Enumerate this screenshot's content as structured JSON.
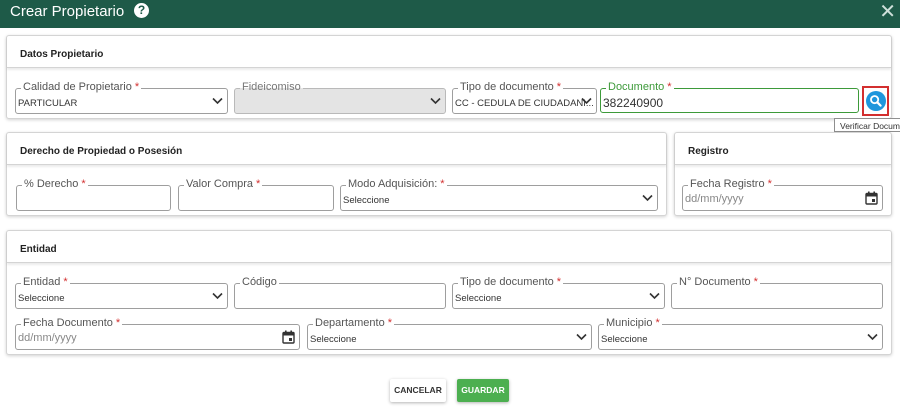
{
  "dialog": {
    "title": "Crear Propietario",
    "help_icon": "?",
    "close_icon": "✕"
  },
  "datos_propietario": {
    "heading": "Datos Propietario",
    "calidad": {
      "label": "Calidad de Propietario",
      "value": "PARTICULAR"
    },
    "fideicomiso": {
      "label": "Fideicomiso",
      "value": ""
    },
    "tipo_documento": {
      "label": "Tipo de documento",
      "value": "CC - CEDULA DE CIUDADANI..."
    },
    "documento": {
      "label": "Documento",
      "value": "382240900"
    },
    "verify_tooltip": "Verificar Documento"
  },
  "derecho": {
    "heading": "Derecho de Propiedad o Posesión",
    "porcentaje": {
      "label": "% Derecho",
      "value": ""
    },
    "valor_compra": {
      "label": "Valor Compra",
      "value": ""
    },
    "modo_adquisicion": {
      "label": "Modo Adquisición:",
      "value": "Seleccione"
    }
  },
  "registro": {
    "heading": "Registro",
    "fecha_registro": {
      "label": "Fecha Registro",
      "placeholder": "dd/mm/yyyy"
    }
  },
  "entidad": {
    "heading": "Entidad",
    "entidad": {
      "label": "Entidad",
      "value": "Seleccione"
    },
    "codigo": {
      "label": "Código",
      "value": ""
    },
    "tipo_documento": {
      "label": "Tipo de documento",
      "value": "Seleccione"
    },
    "numero_documento": {
      "label": "N° Documento",
      "value": ""
    },
    "fecha_documento": {
      "label": "Fecha Documento",
      "placeholder": "dd/mm/yyyy"
    },
    "departamento": {
      "label": "Departamento",
      "value": "Seleccione"
    },
    "municipio": {
      "label": "Municipio",
      "value": "Seleccione"
    }
  },
  "actions": {
    "cancel": "CANCELAR",
    "save": "GUARDAR"
  },
  "required_mark": "*",
  "colors": {
    "titlebar": "#1e5a48",
    "required": "#d32f2f",
    "focus": "#3d9a3a",
    "save_button": "#4caf50",
    "verify_button": "#1f96dc"
  }
}
